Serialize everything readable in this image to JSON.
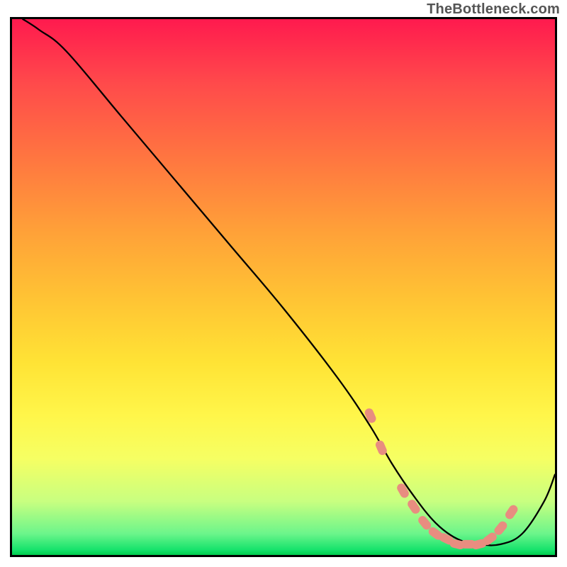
{
  "attribution": "TheBottleneck.com",
  "chart_data": {
    "type": "line",
    "title": "",
    "xlabel": "",
    "ylabel": "",
    "xlim": [
      0,
      100
    ],
    "ylim": [
      0,
      100
    ],
    "series": [
      {
        "name": "curve",
        "x": [
          2,
          5,
          10,
          20,
          30,
          40,
          50,
          60,
          66,
          70,
          74,
          78,
          82,
          86,
          90,
          94,
          98,
          100
        ],
        "values": [
          100,
          98,
          94,
          82,
          70,
          58,
          46,
          33,
          24,
          17,
          11,
          6,
          3,
          2,
          2,
          4,
          10,
          15
        ]
      }
    ],
    "markers": {
      "name": "salmon-dots",
      "color": "#e88d80",
      "points_x": [
        66,
        68,
        72,
        74,
        76,
        78,
        80,
        82,
        84,
        86,
        88,
        90,
        92
      ],
      "points_y": [
        26,
        20,
        12,
        9,
        6,
        4,
        3,
        2,
        2,
        2,
        3,
        5,
        8
      ]
    },
    "gradient_stops": [
      {
        "pos": 0,
        "color": "#ff1a4e"
      },
      {
        "pos": 50,
        "color": "#ffd634"
      },
      {
        "pos": 82,
        "color": "#f6ff63"
      },
      {
        "pos": 100,
        "color": "#00cc4e"
      }
    ]
  }
}
